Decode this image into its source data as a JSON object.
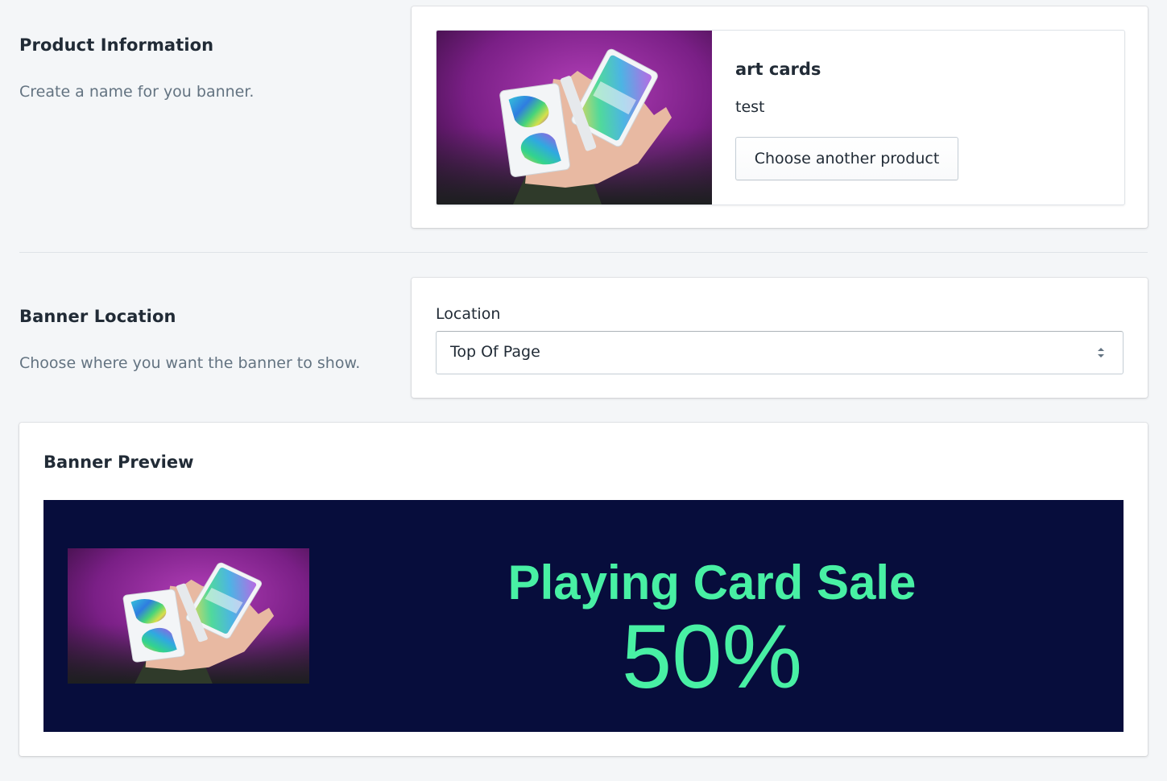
{
  "product_section": {
    "title": "Product Information",
    "description": "Create a name for you banner."
  },
  "product": {
    "name": "art cards",
    "description": "test",
    "choose_button_label": "Choose another product",
    "image_icon": "playing-cards-photo"
  },
  "location_section": {
    "title": "Banner Location",
    "description": "Choose where you want the banner to show.",
    "field_label": "Location",
    "selected_value": "Top Of Page"
  },
  "preview": {
    "title": "Banner Preview",
    "heading": "Playing Card Sale",
    "discount": "50%",
    "colors": {
      "background": "#070d3c",
      "text": "#48f0a4"
    }
  }
}
